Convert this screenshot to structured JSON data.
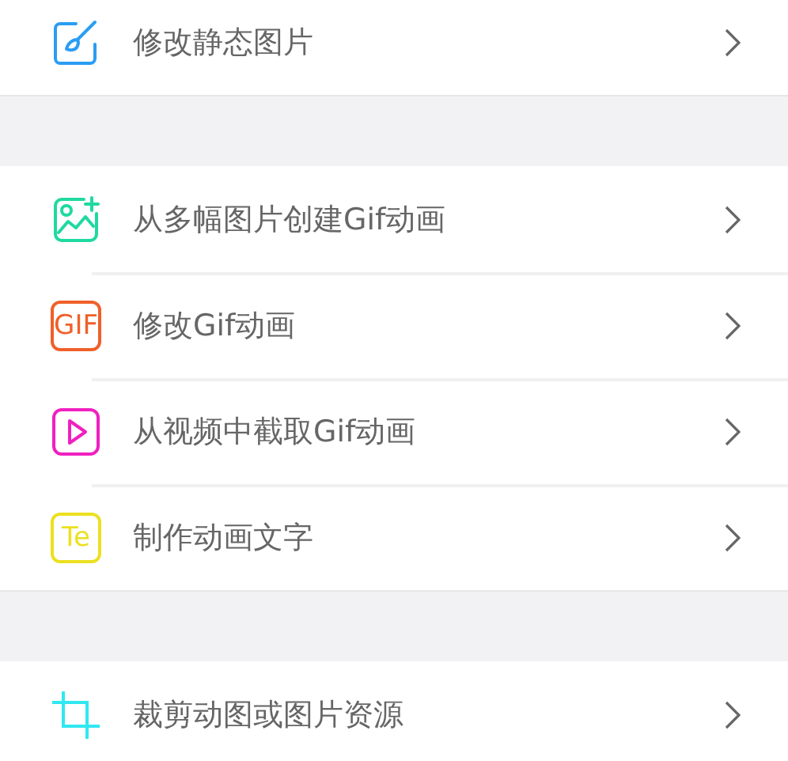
{
  "groups": [
    {
      "items": [
        {
          "kind": "edit",
          "label": "修改静态图片"
        }
      ]
    },
    {
      "items": [
        {
          "kind": "images",
          "label": "从多幅图片创建Gif动画"
        },
        {
          "kind": "gif",
          "icon_text": "GIF",
          "label": "修改Gif动画"
        },
        {
          "kind": "video",
          "label": "从视频中截取Gif动画"
        },
        {
          "kind": "text",
          "icon_text": "Te",
          "label": "制作动画文字"
        }
      ]
    },
    {
      "items": [
        {
          "kind": "crop",
          "label": "裁剪动图或图片资源"
        }
      ]
    }
  ]
}
